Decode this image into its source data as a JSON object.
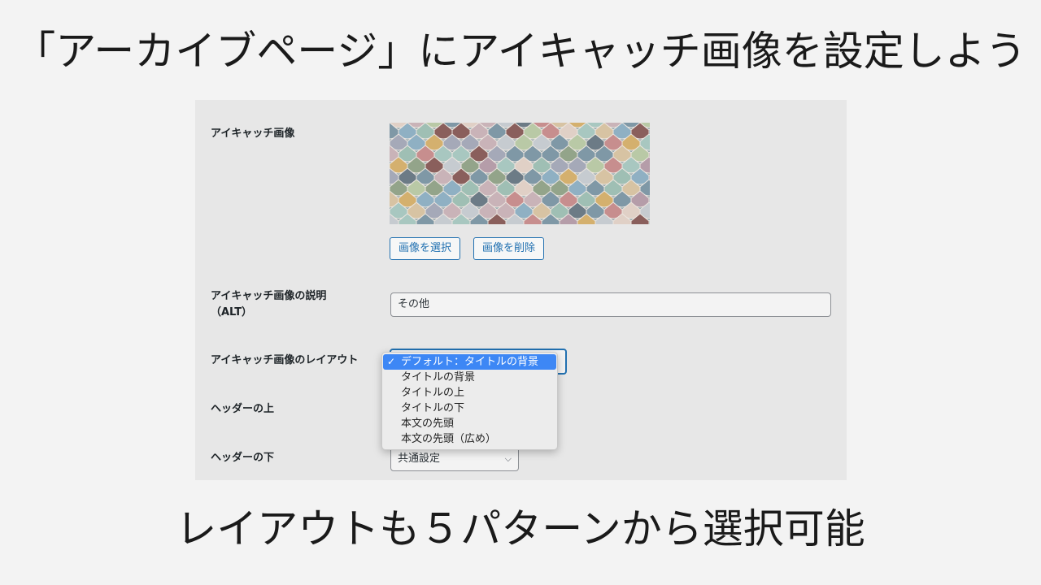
{
  "headline": "「アーカイブページ」にアイキャッチ画像を設定しよう",
  "caption": "レイアウトも５パターンから選択可能",
  "settings": {
    "eyecatch_label": "アイキャッチ画像",
    "select_image_button": "画像を選択",
    "delete_image_button": "画像を削除",
    "alt_label_line1": "アイキャッチ画像の説明",
    "alt_label_line2": "（ALT）",
    "alt_value": "その他",
    "layout_label": "アイキャッチ画像のレイアウト",
    "layout_options": [
      "デフォルト：タイトルの背景",
      "タイトルの背景",
      "タイトルの上",
      "タイトルの下",
      "本文の先頭",
      "本文の先頭（広め）"
    ],
    "layout_selected_index": 0,
    "header_above_label": "ヘッダーの上",
    "header_below_label": "ヘッダーの下",
    "header_below_value": "共通設定"
  },
  "icons": {
    "checkmark": "check-icon",
    "select_arrow": "chevron-down-icon"
  },
  "colors": {
    "accent": "#2271b1",
    "selected_option": "#3d87f5",
    "panel_bg": "#e7e7e7"
  }
}
